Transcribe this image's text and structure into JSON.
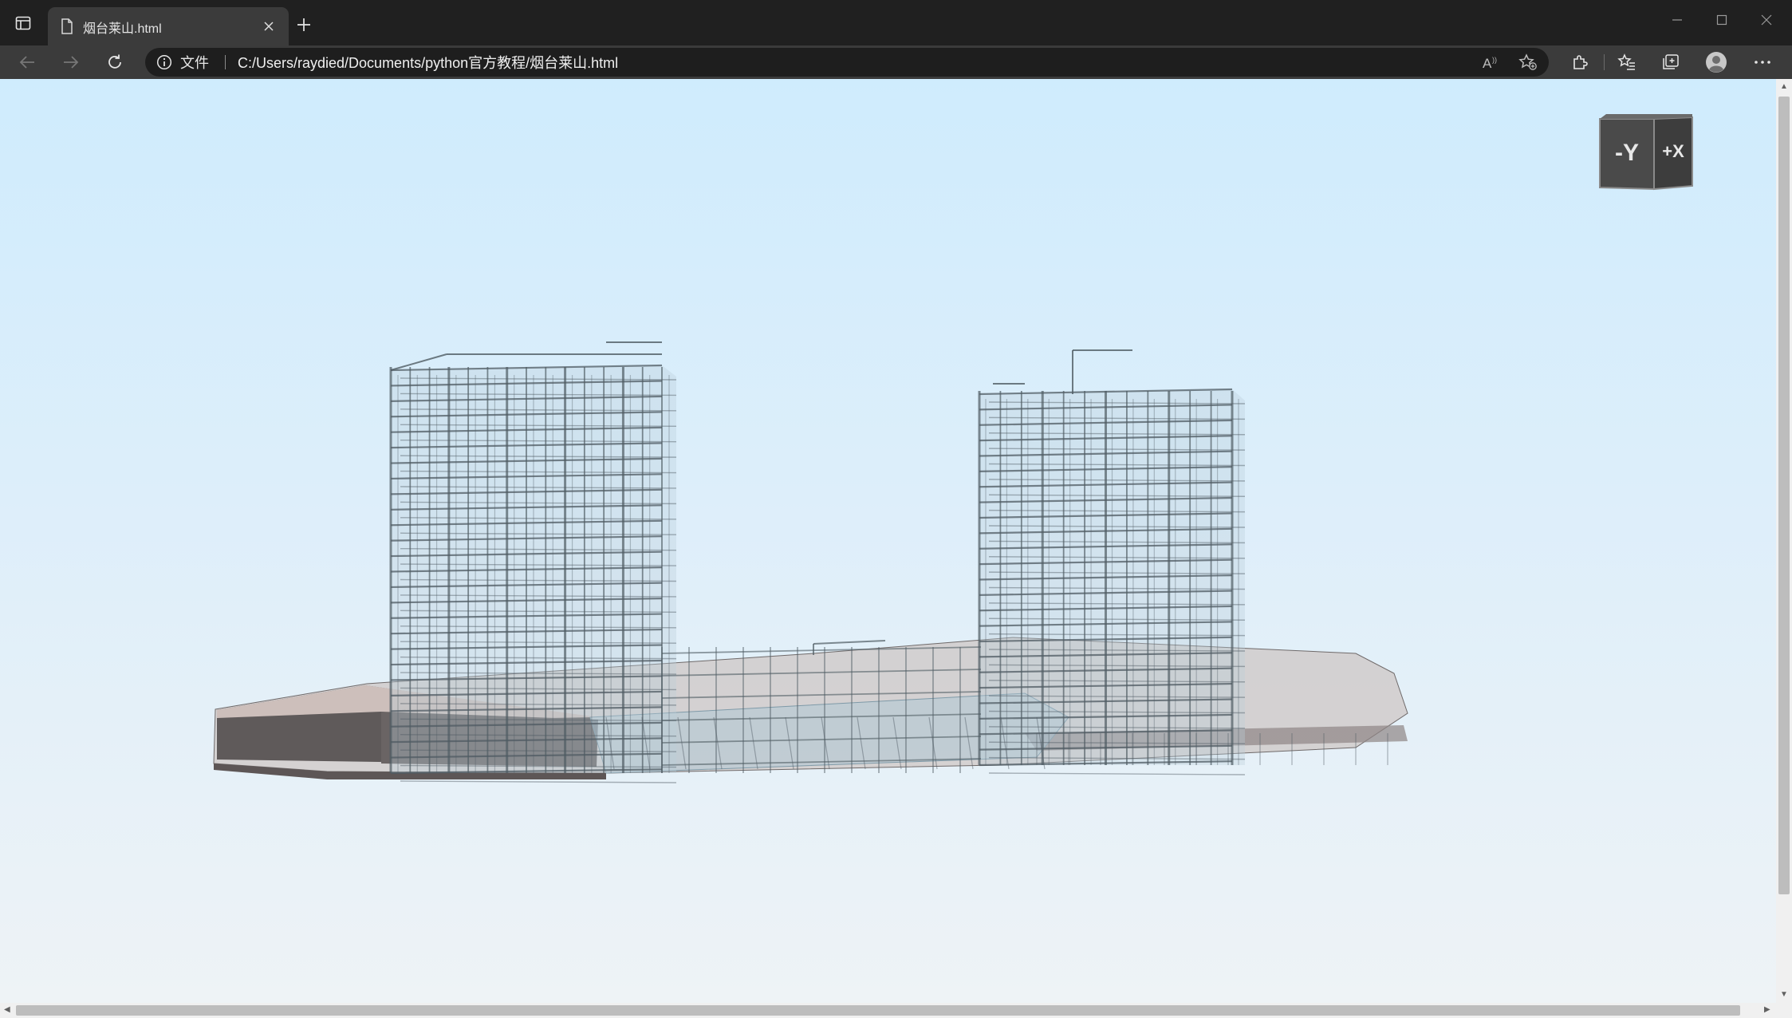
{
  "browser": {
    "tab": {
      "title": "烟台莱山.html"
    },
    "address": {
      "site_label": "文件",
      "url": "C:/Users/raydied/Documents/python官方教程/烟台莱山.html"
    }
  },
  "viewer": {
    "viewcube": {
      "front_face": "-Y",
      "side_face": "+X"
    }
  }
}
